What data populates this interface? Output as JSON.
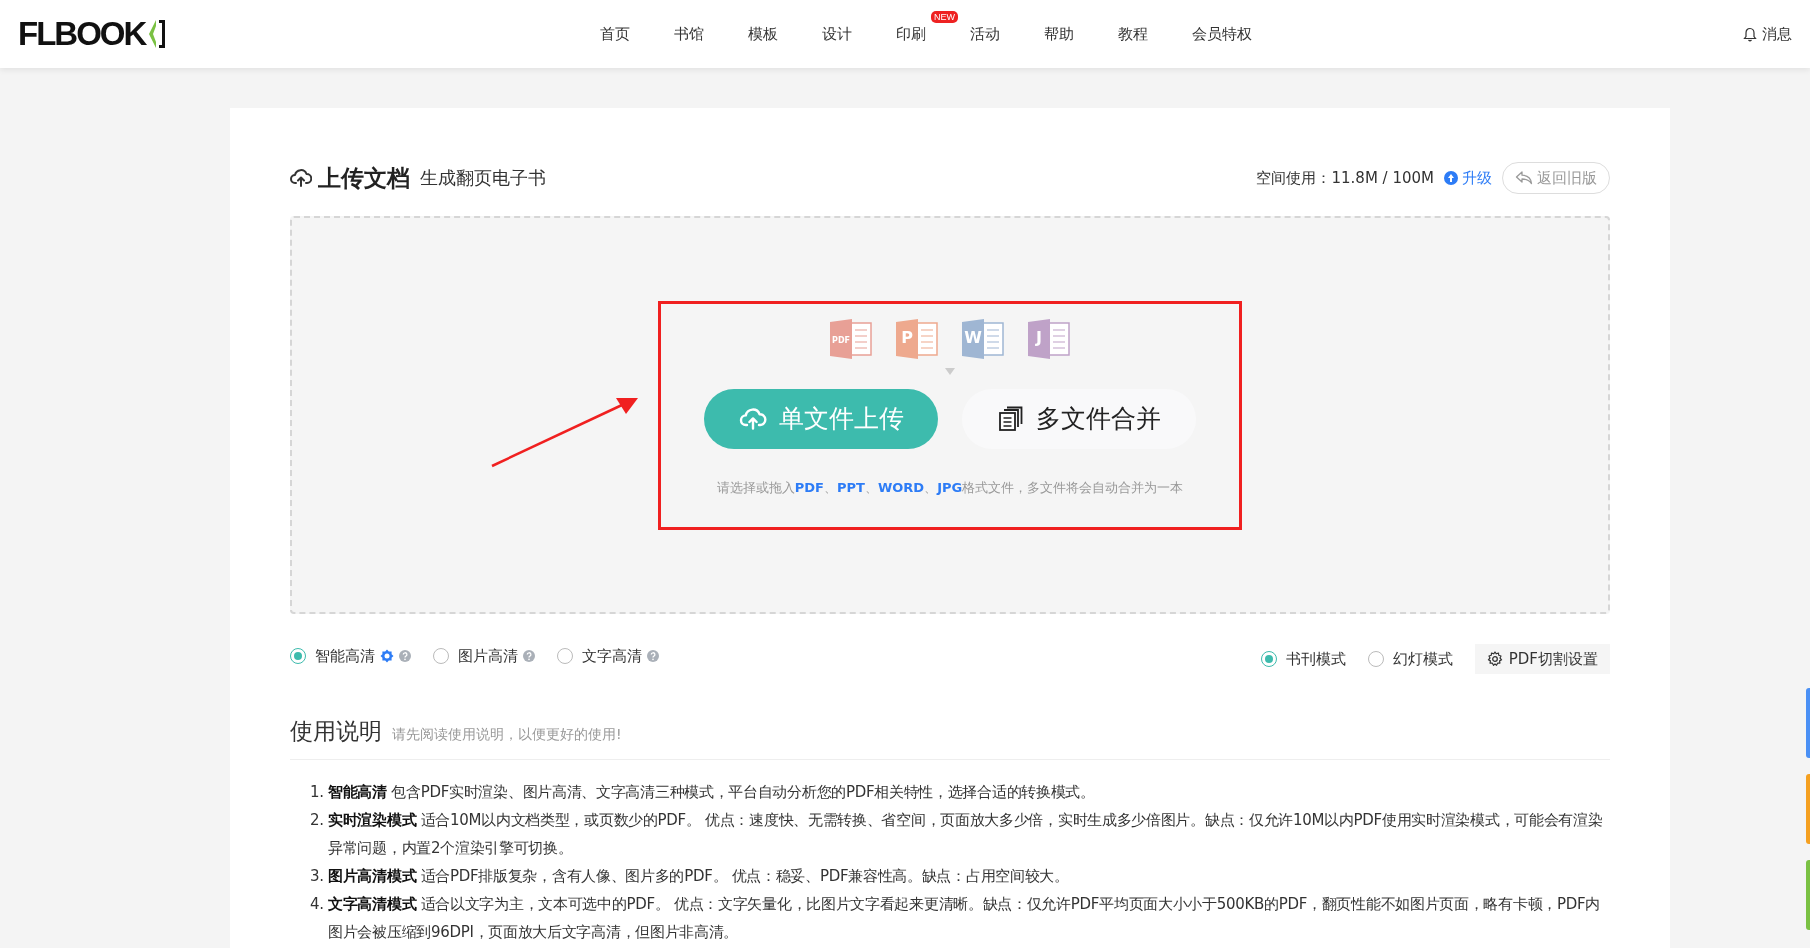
{
  "header": {
    "logo": "FLBOOK",
    "nav": [
      {
        "label": "首页"
      },
      {
        "label": "书馆"
      },
      {
        "label": "模板"
      },
      {
        "label": "设计"
      },
      {
        "label": "印刷",
        "badge": "NEW"
      },
      {
        "label": "活动"
      },
      {
        "label": "帮助"
      },
      {
        "label": "教程"
      },
      {
        "label": "会员特权"
      }
    ],
    "messages": "消息"
  },
  "upload": {
    "title": "上传文档",
    "subtitle": "生成翻页电子书",
    "storage_label": "空间使用：11.8M / 100M",
    "upgrade": "升级",
    "old_version": "返回旧版",
    "file_types": [
      {
        "kind": "pdf",
        "letter": "PDF"
      },
      {
        "kind": "ppt",
        "letter": "P"
      },
      {
        "kind": "word",
        "letter": "W"
      },
      {
        "kind": "jpg",
        "letter": "J"
      }
    ],
    "single_button": "单文件上传",
    "multi_button": "多文件合并",
    "hint": "请选择或拖入**PDF**、**PPT**、**WORD**、**JPG**格式文件，多文件将会自动合并为一本"
  },
  "quality_options": [
    {
      "label": "智能高清",
      "selected": true,
      "badge": true
    },
    {
      "label": "图片高清",
      "selected": false,
      "badge": false
    },
    {
      "label": "文字高清",
      "selected": false,
      "badge": false
    }
  ],
  "layout_options": [
    {
      "label": "书刊模式",
      "selected": true
    },
    {
      "label": "幻灯模式",
      "selected": false
    }
  ],
  "pdf_settings": "PDF切割设置",
  "instructions": {
    "title": "使用说明",
    "subtitle": "请先阅读使用说明，以便更好的使用!",
    "items": [
      {
        "number": "1.",
        "text": "**智能高清** 包含PDF实时渲染、图片高清、文字高清三种模式，平台自动分析您的PDF相关特性，选择合适的转换模式。"
      },
      {
        "number": "2.",
        "text": "**实时渲染模式** 适合10M以内文档类型，或页数少的PDF。 优点：速度快、无需转换、省空间，页面放大多少倍，实时生成多少倍图片。缺点：仅允许10M以内PDF使用实时渲染模式，可能会有渲染异常问题，内置2个渲染引擎可切换。"
      },
      {
        "number": "3.",
        "text": "**图片高清模式** 适合PDF排版复杂，含有人像、图片多的PDF。 优点：稳妥、PDF兼容性高。缺点：占用空间较大。"
      },
      {
        "number": "4.",
        "text": "**文字高清模式** 适合以文字为主，文本可选中的PDF。 优点：文字矢量化，比图片文字看起来更清晰。缺点：仅允许PDF平均页面大小小于500KB的PDF，翻页性能不如图片页面，略有卡顿，PDF内图片会被压缩到96DPI，页面放大后文字高清，但图片非高清。"
      }
    ]
  },
  "side_tabs": [
    {
      "color": "#4a90f5"
    },
    {
      "color": "#f5a020"
    },
    {
      "color": "#7ac143"
    }
  ]
}
